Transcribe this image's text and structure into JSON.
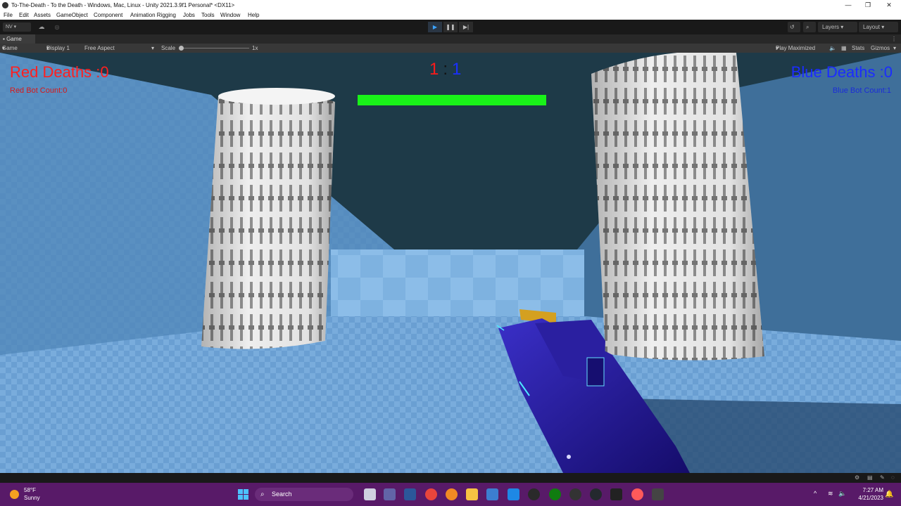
{
  "window": {
    "title": "To-The-Death - To the Death - Windows, Mac, Linux - Unity 2021.3.9f1 Personal* <DX11>"
  },
  "menu": [
    "File",
    "Edit",
    "Assets",
    "GameObject",
    "Component",
    "Animation Rigging",
    "Jobs",
    "Tools",
    "Window",
    "Help"
  ],
  "toolbar": {
    "account": "NV ▾",
    "layers": "Layers",
    "layout": "Layout"
  },
  "game_tab": {
    "label": "Game"
  },
  "game_bar": {
    "mode": "Game",
    "display": "Display 1",
    "aspect": "Free Aspect",
    "scale_label": "Scale",
    "scale_value": "1x",
    "play_maximized": "Play Maximized",
    "stats": "Stats",
    "gizmos": "Gizmos"
  },
  "hud": {
    "red_deaths": "Red Deaths :0",
    "red_bot_count": "Red Bot Count:0",
    "blue_deaths": "Blue Deaths :0",
    "blue_bot_count": "Blue Bot Count:1",
    "score_red": "1",
    "score_sep": ":",
    "score_blue": "1",
    "health_fraction": 1.0,
    "health_color": "#19f219"
  },
  "taskbar": {
    "weather_temp": "58°F",
    "weather_condition": "Sunny",
    "search": "Search",
    "time": "7:27 AM",
    "date": "4/21/2023",
    "accent": "#581a68"
  }
}
